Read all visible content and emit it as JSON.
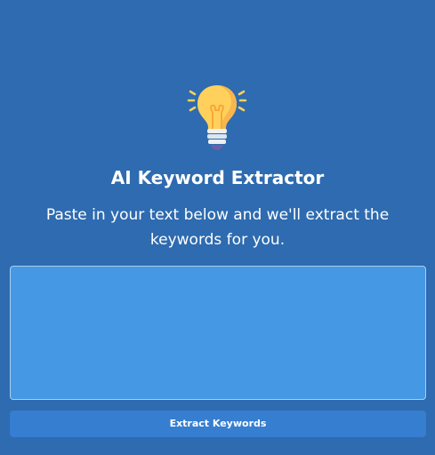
{
  "app": {
    "icon": "lightbulb-icon",
    "title": "AI Keyword Extractor",
    "subtitle": "Paste in your text below and we'll extract the keywords for you."
  },
  "input": {
    "value": "",
    "placeholder": ""
  },
  "actions": {
    "extract_label": "Extract Keywords"
  },
  "colors": {
    "background": "#2e6bb0",
    "textarea_bg": "#4598e3",
    "button_bg": "#367ed0",
    "bulb_yellow": "#ffd15c"
  }
}
